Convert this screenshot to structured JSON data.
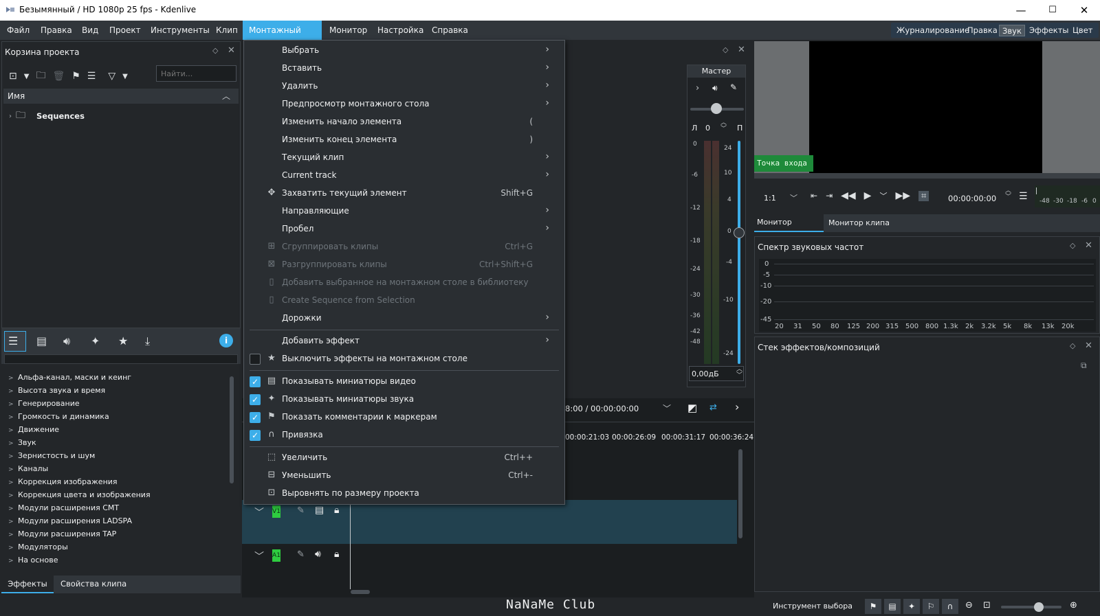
{
  "window": {
    "title": "Безымянный / HD 1080p 25 fps - Kdenlive",
    "minimize": "—",
    "maximize": "☐",
    "close": "✕"
  },
  "menubar": {
    "items": [
      "Файл",
      "Правка",
      "Вид",
      "Проект",
      "Инструменты",
      "Клип",
      "Монтажный стол",
      "Монитор",
      "Настройка",
      "Справка"
    ],
    "active": "Монтажный стол"
  },
  "workspaces": [
    "Журналирование",
    "Правка",
    "Звук",
    "Эффекты",
    "Цвет"
  ],
  "workspace_active": "Звук",
  "bin": {
    "title": "Корзина проекта",
    "search_placeholder": "Найти...",
    "column": "Имя",
    "items": [
      "Sequences"
    ]
  },
  "effects": {
    "categories": [
      "Альфа-канал, маски и кеинг",
      "Высота звука и время",
      "Генерирование",
      "Громкость и динамика",
      "Движение",
      "Звук",
      "Зернистость и шум",
      "Каналы",
      "Коррекция изображения",
      "Коррекция цвета и изображения",
      "Модули расширения CMT",
      "Модули расширения LADSPA",
      "Модули расширения TAP",
      "Модуляторы",
      "На основе"
    ],
    "tabs": [
      "Эффекты",
      "Свойства клипа"
    ],
    "info_icon": "i"
  },
  "menu": {
    "items": [
      {
        "label": "Выбрать",
        "sub": true
      },
      {
        "label": "Вставить",
        "sub": true
      },
      {
        "label": "Удалить",
        "sub": true
      },
      {
        "label": "Предпросмотр монтажного стола",
        "sub": true
      },
      {
        "label": "Изменить начало элемента",
        "shortcut": "("
      },
      {
        "label": "Изменить конец элемента",
        "shortcut": ")"
      },
      {
        "label": "Текущий клип",
        "sub": true
      },
      {
        "label": "Current track",
        "sub": true
      },
      {
        "label": "Захватить текущий элемент",
        "shortcut": "Shift+G"
      },
      {
        "label": "Направляющие",
        "sub": true
      },
      {
        "label": "Пробел",
        "sub": true
      },
      {
        "label": "Сгруппировать клипы",
        "shortcut": "Ctrl+G",
        "disabled": true
      },
      {
        "label": "Разгруппировать клипы",
        "shortcut": "Ctrl+Shift+G",
        "disabled": true
      },
      {
        "label": "Добавить выбранное на монтажном столе в библиотеку",
        "disabled": true
      },
      {
        "label": "Create Sequence from Selection",
        "disabled": true
      },
      {
        "label": "Дорожки",
        "sub": true
      },
      {
        "label": "Добавить эффект",
        "sub": true
      },
      {
        "label": "Выключить эффекты на монтажном столе",
        "checkbox": false
      },
      {
        "label": "Показывать миниатюры видео",
        "checkbox": true
      },
      {
        "label": "Показывать миниатюры звука",
        "checkbox": true
      },
      {
        "label": "Показать комментарии к маркерам",
        "checkbox": true
      },
      {
        "label": "Привязка",
        "checkbox": true
      },
      {
        "label": "Увеличить",
        "shortcut": "Ctrl++"
      },
      {
        "label": "Уменьшить",
        "shortcut": "Ctrl+-"
      },
      {
        "label": "Выровнять по размеру проекта"
      }
    ]
  },
  "mixer": {
    "title": "Мастер",
    "left": "Л",
    "right": "П",
    "balance": "0",
    "level": "0,00дБ",
    "meter_ticks": [
      "0",
      "-6",
      "-12",
      "-18",
      "-24",
      "-30",
      "-36",
      "-42",
      "-48"
    ],
    "fader_ticks": [
      "24",
      "10",
      "4",
      "0",
      "-4",
      "-10",
      "-24"
    ]
  },
  "monitor": {
    "in_point": "Точка входа",
    "zoom": "1:1",
    "timecode": "00:00:00:00",
    "tabs": [
      "Монитор проекта",
      "Монитор клипа"
    ],
    "audio_scale": [
      "-48",
      "-30",
      "-18",
      "-6",
      "0"
    ]
  },
  "spectrum": {
    "title": "Спектр звуковых частот",
    "y_labels": [
      "0",
      "-5",
      "-10",
      "-20",
      "-45"
    ],
    "x_labels": [
      "20",
      "31",
      "50",
      "80",
      "125",
      "200",
      "315",
      "500",
      "800",
      "1.3k",
      "2k",
      "3.2k",
      "5k",
      "8k",
      "13k",
      "20k"
    ]
  },
  "effect_stack": {
    "title": "Стек эффектов/композиций"
  },
  "timeline": {
    "position": "8:00 / 00:00:00:00",
    "ruler": [
      "00:00:21:03",
      "00:00:26:09",
      "00:00:31:17",
      "00:00:36:24"
    ],
    "tracks": [
      "V1",
      "A1"
    ]
  },
  "statusbar": {
    "watermark": "NaNaMe Club",
    "tool": "Инструмент выбора"
  },
  "colors": {
    "accent": "#3daee9",
    "bg": "#232629",
    "green": "#2ecc40"
  }
}
